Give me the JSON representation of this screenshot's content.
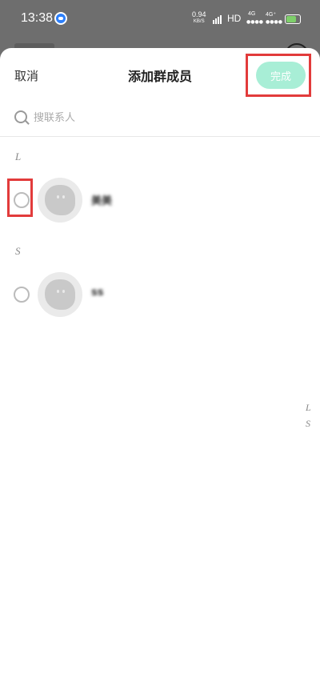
{
  "status_bar": {
    "time": "13:38",
    "net_speed": "0.94",
    "net_speed_unit": "KB/S",
    "hd": "HD",
    "net1": "4G",
    "net2": "4G⁺"
  },
  "header": {
    "cancel_label": "取消",
    "title": "添加群成员",
    "done_label": "完成"
  },
  "search": {
    "placeholder": "搜联系人"
  },
  "sections": [
    {
      "letter": "L",
      "contacts": [
        {
          "name": "美美",
          "checked": false
        }
      ]
    },
    {
      "letter": "S",
      "contacts": [
        {
          "name": "ss",
          "checked": false
        }
      ]
    }
  ],
  "index_letters": [
    "L",
    "S"
  ],
  "colors": {
    "accent_button": "#a8eed6",
    "highlight_box": "#e23b3b"
  }
}
